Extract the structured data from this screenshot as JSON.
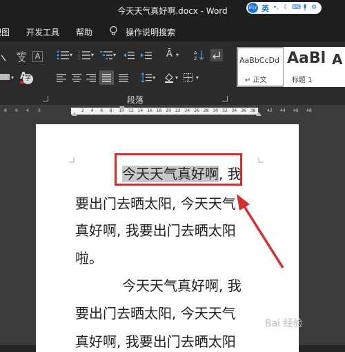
{
  "window": {
    "title": "今天天气真好啊.docx  -  Word"
  },
  "ime": {
    "logo": "iFLY",
    "lang": "英"
  },
  "menu": {
    "view": "视图",
    "developer": "开发工具",
    "help": "帮助",
    "tell_me": "操作说明搜索"
  },
  "ribbon": {
    "wen_top": "wén",
    "wen": "文",
    "A": "A",
    "paragraph_group": "段落",
    "circle_char": "字"
  },
  "styles": [
    {
      "preview": "AaBbCcDd",
      "name": "↵ 正文"
    },
    {
      "preview": "AaBl",
      "name": "标题 1"
    },
    {
      "preview": "A",
      "name": ""
    }
  ],
  "ruler": {
    "left_ticks": [
      "8",
      "6",
      "4",
      "2"
    ],
    "main_ticks": [
      "2",
      "4",
      "6",
      "8",
      "10",
      "12",
      "14",
      "16",
      "18",
      "20",
      "22",
      "24",
      "26",
      "28",
      "30",
      "32",
      "34",
      "36",
      "38"
    ],
    "right_ticks": [
      "42",
      "44",
      "46",
      "48"
    ]
  },
  "document": {
    "para1": {
      "highlighted": "今天天气真好啊",
      "line1_rest": ", 我",
      "line2": "要出门去晒太阳, 今天天气",
      "line3": "真好啊, 我要出门去晒太阳",
      "line4": "啦。"
    },
    "para2": {
      "line1": "今天天气真好啊, 我",
      "line2": "要出门去晒太阳, 今天天气",
      "line3": "真好啊, 我要出门去晒太阳"
    }
  },
  "watermark": "Bai 经验",
  "colors": {
    "annotation_red": "#d42f2f",
    "dark_bg": "#1e1e1e",
    "ribbon_bg": "#2b2b2b"
  }
}
